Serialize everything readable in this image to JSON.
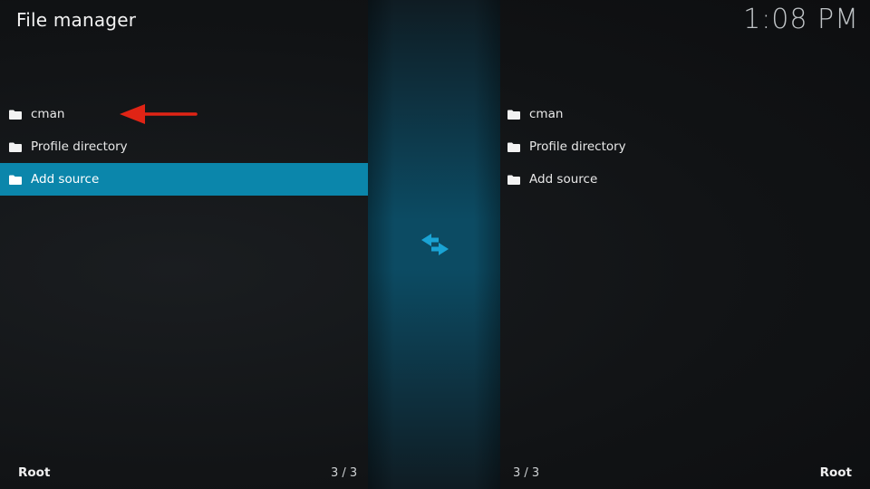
{
  "header": {
    "title": "File manager",
    "clock": "1:08 PM"
  },
  "left_pane": {
    "items": [
      {
        "label": "cman",
        "icon": "folder-icon"
      },
      {
        "label": "Profile directory",
        "icon": "folder-icon"
      },
      {
        "label": "Add source",
        "icon": "folder-icon",
        "selected": true
      }
    ],
    "footer_label": "Root",
    "footer_count": "3 / 3"
  },
  "right_pane": {
    "items": [
      {
        "label": "cman",
        "icon": "folder-icon"
      },
      {
        "label": "Profile directory",
        "icon": "folder-icon"
      },
      {
        "label": "Add source",
        "icon": "folder-icon"
      }
    ],
    "footer_label": "Root",
    "footer_count": "3 / 3"
  },
  "divider": {
    "icon": "swap-arrows-icon"
  },
  "annotation": {
    "icon": "red-arrow-left-icon",
    "color": "#e02415"
  },
  "colors": {
    "selection": "#0b86ab",
    "accent": "#1aa3d4",
    "background": "#111315"
  }
}
